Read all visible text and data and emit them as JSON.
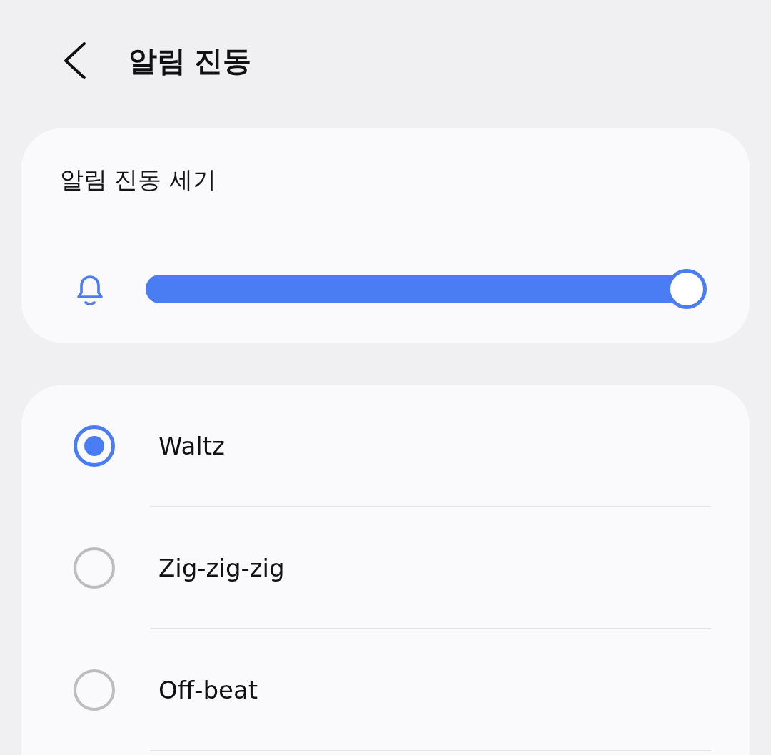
{
  "header": {
    "title": "알림 진동"
  },
  "intensity": {
    "label": "알림 진동 세기",
    "level": 1
  },
  "patterns": [
    {
      "label": "Waltz",
      "selected": true
    },
    {
      "label": "Zig-zig-zig",
      "selected": false
    },
    {
      "label": "Off-beat",
      "selected": false
    }
  ]
}
